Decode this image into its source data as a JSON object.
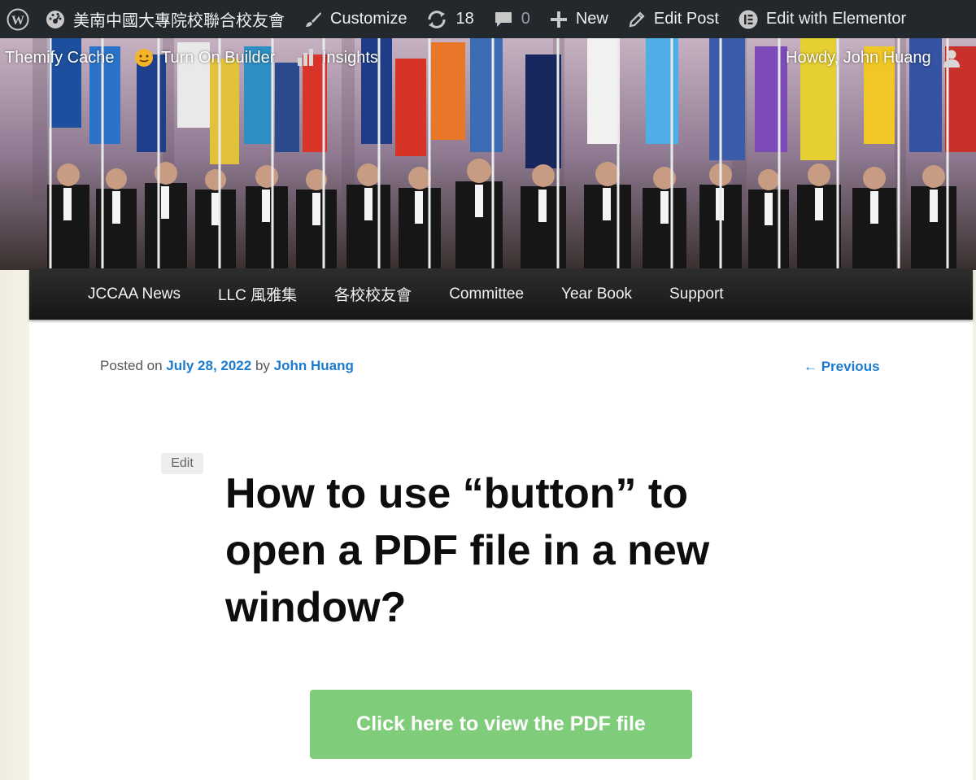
{
  "admin_bar": {
    "site_name": "美南中國大專院校聯合校友會",
    "customize": "Customize",
    "updates_count": "18",
    "comments_count": "0",
    "new_label": "New",
    "edit_post": "Edit Post",
    "edit_elementor": "Edit with Elementor",
    "themify_cache": "Themify Cache",
    "turn_on_builder": "Turn On Builder",
    "insights": "Insights",
    "howdy": "Howdy, John Huang"
  },
  "nav": {
    "items": [
      "JCCAA News",
      "LLC 風雅集",
      "各校校友會",
      "Committee",
      "Year Book",
      "Support"
    ]
  },
  "post": {
    "posted_on_prefix": "Posted on",
    "date": "July 28, 2022",
    "by": "by",
    "author": "John Huang",
    "previous": "← Previous",
    "edit": "Edit",
    "title": "How to use “button” to open a PDF file in a new window?",
    "button_label": "Click here to view the PDF file"
  },
  "colors": {
    "admin_bar_bg": "#23282d",
    "link": "#1b7bd0",
    "button_bg": "#7fcd7a",
    "nav_bg": "#1e1e1e"
  }
}
